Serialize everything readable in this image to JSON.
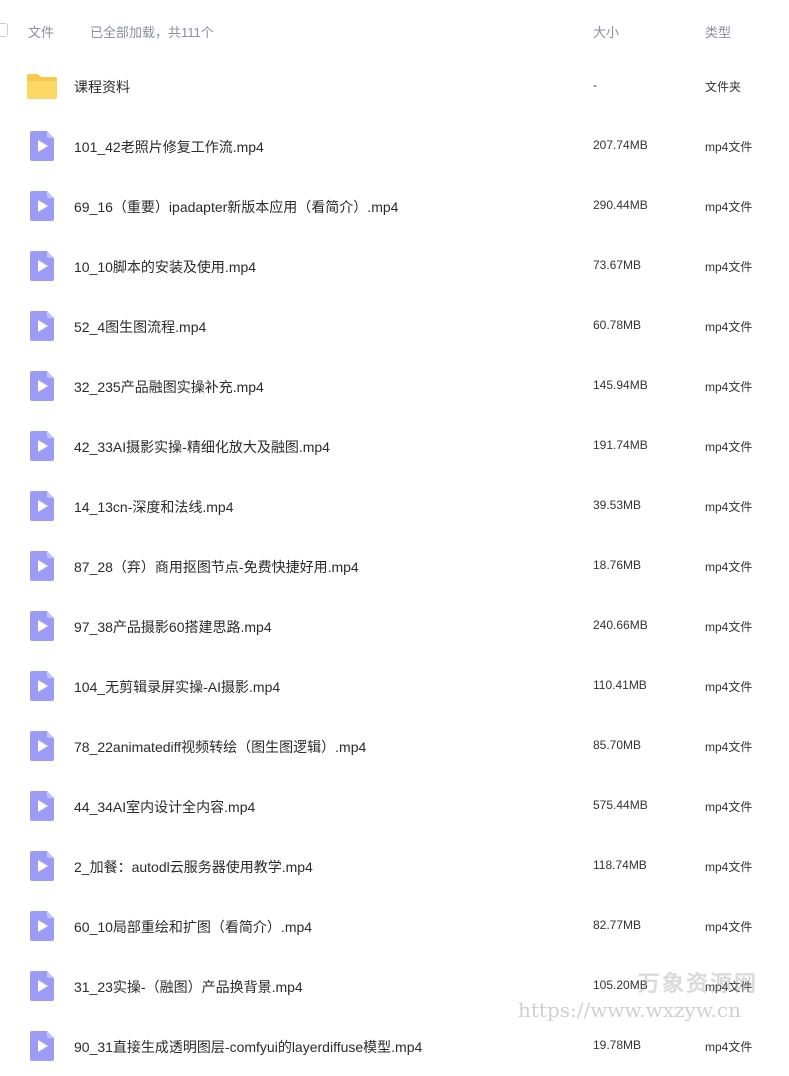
{
  "header": {
    "file_label": "文件",
    "status": "已全部加载，共111个",
    "size_label": "大小",
    "type_label": "类型"
  },
  "colors": {
    "folder": "#f7c84a",
    "video": "#9a9cf5"
  },
  "rows": [
    {
      "icon": "folder-icon",
      "name": "课程资料",
      "size": "-",
      "type": "文件夹"
    },
    {
      "icon": "video-file-icon",
      "name": "101_42老照片修复工作流.mp4",
      "size": "207.74MB",
      "type": "mp4文件"
    },
    {
      "icon": "video-file-icon",
      "name": "69_16（重要）ipadapter新版本应用（看简介）.mp4",
      "size": "290.44MB",
      "type": "mp4文件"
    },
    {
      "icon": "video-file-icon",
      "name": "10_10脚本的安装及使用.mp4",
      "size": "73.67MB",
      "type": "mp4文件"
    },
    {
      "icon": "video-file-icon",
      "name": "52_4图生图流程.mp4",
      "size": "60.78MB",
      "type": "mp4文件"
    },
    {
      "icon": "video-file-icon",
      "name": "32_235产品融图实操补充.mp4",
      "size": "145.94MB",
      "type": "mp4文件"
    },
    {
      "icon": "video-file-icon",
      "name": "42_33AI摄影实操-精细化放大及融图.mp4",
      "size": "191.74MB",
      "type": "mp4文件"
    },
    {
      "icon": "video-file-icon",
      "name": "14_13cn-深度和法线.mp4",
      "size": "39.53MB",
      "type": "mp4文件"
    },
    {
      "icon": "video-file-icon",
      "name": "87_28（弃）商用抠图节点-免费快捷好用.mp4",
      "size": "18.76MB",
      "type": "mp4文件"
    },
    {
      "icon": "video-file-icon",
      "name": "97_38产品摄影60搭建思路.mp4",
      "size": "240.66MB",
      "type": "mp4文件"
    },
    {
      "icon": "video-file-icon",
      "name": "104_无剪辑录屏实操-AI摄影.mp4",
      "size": "110.41MB",
      "type": "mp4文件"
    },
    {
      "icon": "video-file-icon",
      "name": "78_22animatediff视频转绘（图生图逻辑）.mp4",
      "size": "85.70MB",
      "type": "mp4文件"
    },
    {
      "icon": "video-file-icon",
      "name": "44_34AI室内设计全内容.mp4",
      "size": "575.44MB",
      "type": "mp4文件"
    },
    {
      "icon": "video-file-icon",
      "name": "2_加餐：autodl云服务器使用教学.mp4",
      "size": "118.74MB",
      "type": "mp4文件"
    },
    {
      "icon": "video-file-icon",
      "name": "60_10局部重绘和扩图（看简介）.mp4",
      "size": "82.77MB",
      "type": "mp4文件"
    },
    {
      "icon": "video-file-icon",
      "name": "31_23实操-（融图）产品换背景.mp4",
      "size": "105.20MB",
      "type": "mp4文件"
    },
    {
      "icon": "video-file-icon",
      "name": "90_31直接生成透明图层-comfyui的layerdiffuse模型.mp4",
      "size": "19.78MB",
      "type": "mp4文件"
    }
  ],
  "watermark": {
    "brand": "万象资源网",
    "url": "https://www.wxzyw.cn"
  }
}
